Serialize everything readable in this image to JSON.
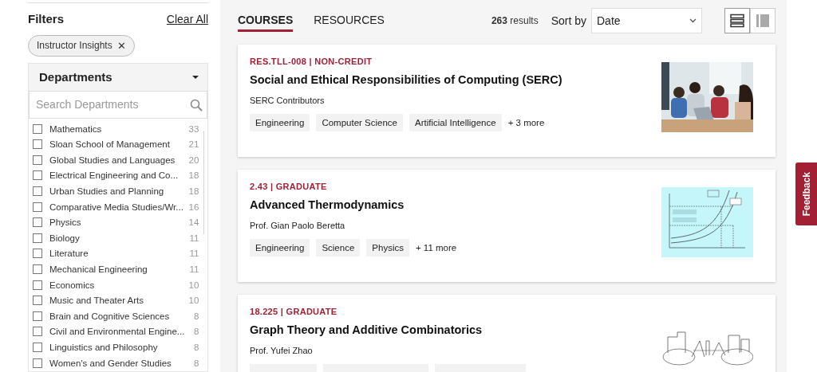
{
  "filters": {
    "title": "Filters",
    "clear_label": "Clear All",
    "active_chips": [
      {
        "label": "Instructor Insights",
        "remove": "✕"
      }
    ],
    "departments": {
      "title": "Departments",
      "expanded": true,
      "search_placeholder": "Search Departments",
      "items": [
        {
          "name": "Mathematics",
          "count": "33",
          "checked": false
        },
        {
          "name": "Sloan School of Management",
          "count": "21",
          "checked": false
        },
        {
          "name": "Global Studies and Languages",
          "count": "20",
          "checked": false
        },
        {
          "name": "Electrical Engineering and Co...",
          "count": "18",
          "checked": false
        },
        {
          "name": "Urban Studies and Planning",
          "count": "18",
          "checked": false
        },
        {
          "name": "Comparative Media Studies/Wr...",
          "count": "16",
          "checked": false
        },
        {
          "name": "Physics",
          "count": "14",
          "checked": false
        },
        {
          "name": "Biology",
          "count": "11",
          "checked": false
        },
        {
          "name": "Literature",
          "count": "11",
          "checked": false
        },
        {
          "name": "Mechanical Engineering",
          "count": "11",
          "checked": false
        },
        {
          "name": "Economics",
          "count": "10",
          "checked": false
        },
        {
          "name": "Music and Theater Arts",
          "count": "10",
          "checked": false
        },
        {
          "name": "Brain and Cognitive Sciences",
          "count": "8",
          "checked": false
        },
        {
          "name": "Civil and Environmental Engine...",
          "count": "8",
          "checked": false
        },
        {
          "name": "Linguistics and Philosophy",
          "count": "8",
          "checked": false
        },
        {
          "name": "Women's and Gender Studies",
          "count": "8",
          "checked": false
        }
      ]
    }
  },
  "tabs": [
    {
      "label": "COURSES",
      "selected": true
    },
    {
      "label": "RESOURCES",
      "selected": false
    }
  ],
  "results": {
    "count": "263",
    "label": "results"
  },
  "sort": {
    "label": "Sort by",
    "value": "Date"
  },
  "view_modes": [
    {
      "kind": "list",
      "selected": true
    },
    {
      "kind": "compact",
      "selected": false
    }
  ],
  "courses": [
    {
      "meta": "RES.TLL-008 | NON-CREDIT",
      "title": "Social and Ethical Responsibilities of Computing (SERC)",
      "instructor": "SERC Contributors",
      "tags": [
        "Engineering",
        "Computer Science",
        "Artificial Intelligence"
      ],
      "more": "+ 3 more"
    },
    {
      "meta": "2.43 | GRADUATE",
      "title": "Advanced Thermodynamics",
      "instructor": "Prof. Gian Paolo Beretta",
      "tags": [
        "Engineering",
        "Science",
        "Physics"
      ],
      "more": "+ 11 more"
    },
    {
      "meta": "18.225 | GRADUATE",
      "title": "Graph Theory and Additive Combinatorics",
      "instructor": "Prof. Yufei Zhao"
    }
  ],
  "feedback": {
    "label": "Feedback"
  }
}
